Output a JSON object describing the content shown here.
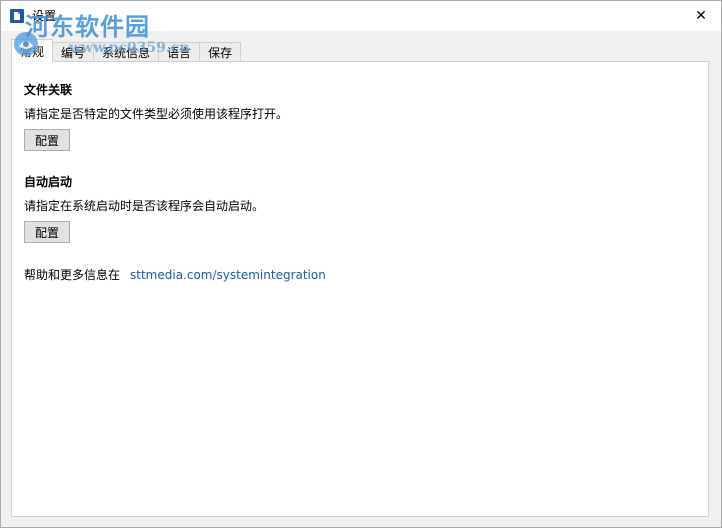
{
  "window": {
    "title": "设置",
    "close_glyph": "✕"
  },
  "tabs": [
    {
      "label": "常规",
      "active": true
    },
    {
      "label": "编号",
      "active": false
    },
    {
      "label": "系统信息",
      "active": false
    },
    {
      "label": "语言",
      "active": false
    },
    {
      "label": "保存",
      "active": false
    }
  ],
  "file_assoc": {
    "title": "文件关联",
    "description": "请指定是否特定的文件类型必须使用该程序打开。",
    "button": "配置"
  },
  "autostart": {
    "title": "自动启动",
    "description": "请指定在系统启动时是否该程序会自动启动。",
    "button": "配置"
  },
  "help": {
    "text": "帮助和更多信息在",
    "link": "sttmedia.com/systemintegration"
  },
  "watermark": {
    "main": "河东软件园",
    "sub": "www.pc0359.cn"
  },
  "colors": {
    "link": "#1a5ea8",
    "watermark": "#3e8fd6"
  },
  "icons": {
    "app": "document-icon",
    "close": "close-icon"
  }
}
